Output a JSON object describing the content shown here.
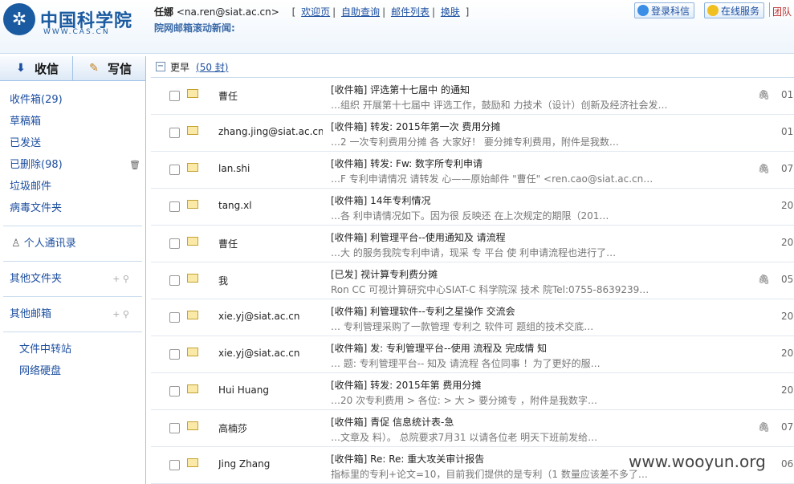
{
  "brand": {
    "name": "中国科学院",
    "sub": "WWW.CAS.CN",
    "logo_icon": "cas-logo-icon"
  },
  "user": {
    "name": "任娜",
    "email": "<na.ren@siat.ac.cn>",
    "links": [
      "欢迎页",
      "自助查询",
      "邮件列表",
      "换肤"
    ]
  },
  "news": "院网邮箱滚动新闻:",
  "header_buttons": {
    "login_kexin": "登录科信",
    "online_service": "在线服务",
    "team": "团队"
  },
  "compose": {
    "inbox": "收信",
    "write": "写信"
  },
  "sidebar": {
    "folders": [
      {
        "label": "收件箱(29)"
      },
      {
        "label": "草稿箱"
      },
      {
        "label": "已发送"
      },
      {
        "label": "已删除(98)"
      },
      {
        "label": "垃圾邮件"
      },
      {
        "label": "病毒文件夹"
      }
    ],
    "contacts": "个人通讯录",
    "other_folders": "其他文件夹",
    "other_mailbox": "其他邮箱",
    "tools": [
      "文件中转站",
      "网络硬盘"
    ]
  },
  "list": {
    "group_name": "更早",
    "group_count": "(50 封)",
    "rows": [
      {
        "sender": "曹任",
        "subject": "[收件箱] 评选第十七届中 的通知",
        "preview": "…组织 开展第十七届中 评选工作，鼓励和 力技术（设计）创新及经济社会发…",
        "attach": true,
        "date": "01"
      },
      {
        "sender": "zhang.jing@siat.ac.cn",
        "subject": "[收件箱] 转发: 2015年第一次 费用分摊",
        "preview": "…2 一次专利费用分摊 各 大家好！ 要分摊专利费用，附件是我数…",
        "attach": false,
        "date": "01"
      },
      {
        "sender": "lan.shi",
        "subject": "[收件箱] 转发: Fw: 数字所专利申请",
        "preview": "…F 专利申请情况 请转发 心——原始邮件 \"曹任\" <ren.cao@siat.ac.cn…",
        "attach": true,
        "date": "07"
      },
      {
        "sender": "tang.xl",
        "subject": "[收件箱] 14年专利情况",
        "preview": "…各 利申请情况如下。因为很 反映还 在上次规定的期限（201…",
        "attach": false,
        "date": "20"
      },
      {
        "sender": "曹任",
        "subject": "[收件箱] 利管理平台--使用通知及 请流程",
        "preview": "…大 的服务我院专利申请，现采 专 平台 使 利申请流程也进行了…",
        "attach": false,
        "date": "20"
      },
      {
        "sender": "我",
        "subject": "[已发] 视计算专利费分摊",
        "preview": "Ron CC 可视计算研究中心SIAT-C 科学院深 技术 院Tel:0755-8639239…",
        "attach": true,
        "date": "05"
      },
      {
        "sender": "xie.yj@siat.ac.cn",
        "subject": "[收件箱] 利管理软件--专利之星操作 交流会",
        "preview": "… 专利管理采购了一款管理 专利之 软件可 题组的技术交底…",
        "attach": false,
        "date": "20"
      },
      {
        "sender": "xie.yj@siat.ac.cn",
        "subject": "[收件箱] 发: 专利管理平台--使用 流程及 完成情 知",
        "preview": "… 题: 专利管理平台-- 知及 请流程 各位同事 ！为了更好的服…",
        "attach": false,
        "date": "20"
      },
      {
        "sender": "Hui Huang",
        "subject": "[收件箱] 转发: 2015年第 费用分摊",
        "preview": "…20 次专利费用 > 各位: > 大 > 要分摊专 ，附件是我数字…",
        "attach": false,
        "date": "20"
      },
      {
        "sender": "高楠莎",
        "subject": "[收件箱] 青促 信息统计表-急",
        "preview": "…文章及 料）。 总院要求7月31 以请各位老 明天下班前发给…",
        "attach": true,
        "date": "07"
      },
      {
        "sender": "Jing Zhang",
        "subject": "[收件箱] Re: Re: 重大攻关审计报告",
        "preview": "指标里的专利+论文=10，目前我们提供的是专利（1 数量应该差不多了…",
        "attach": false,
        "date": "06"
      }
    ]
  },
  "watermark": "www.wooyun.org",
  "colors": {
    "link": "#1d4fa0",
    "border": "#9fc2e6",
    "brand": "#1a5aa0",
    "team": "#c03030"
  }
}
